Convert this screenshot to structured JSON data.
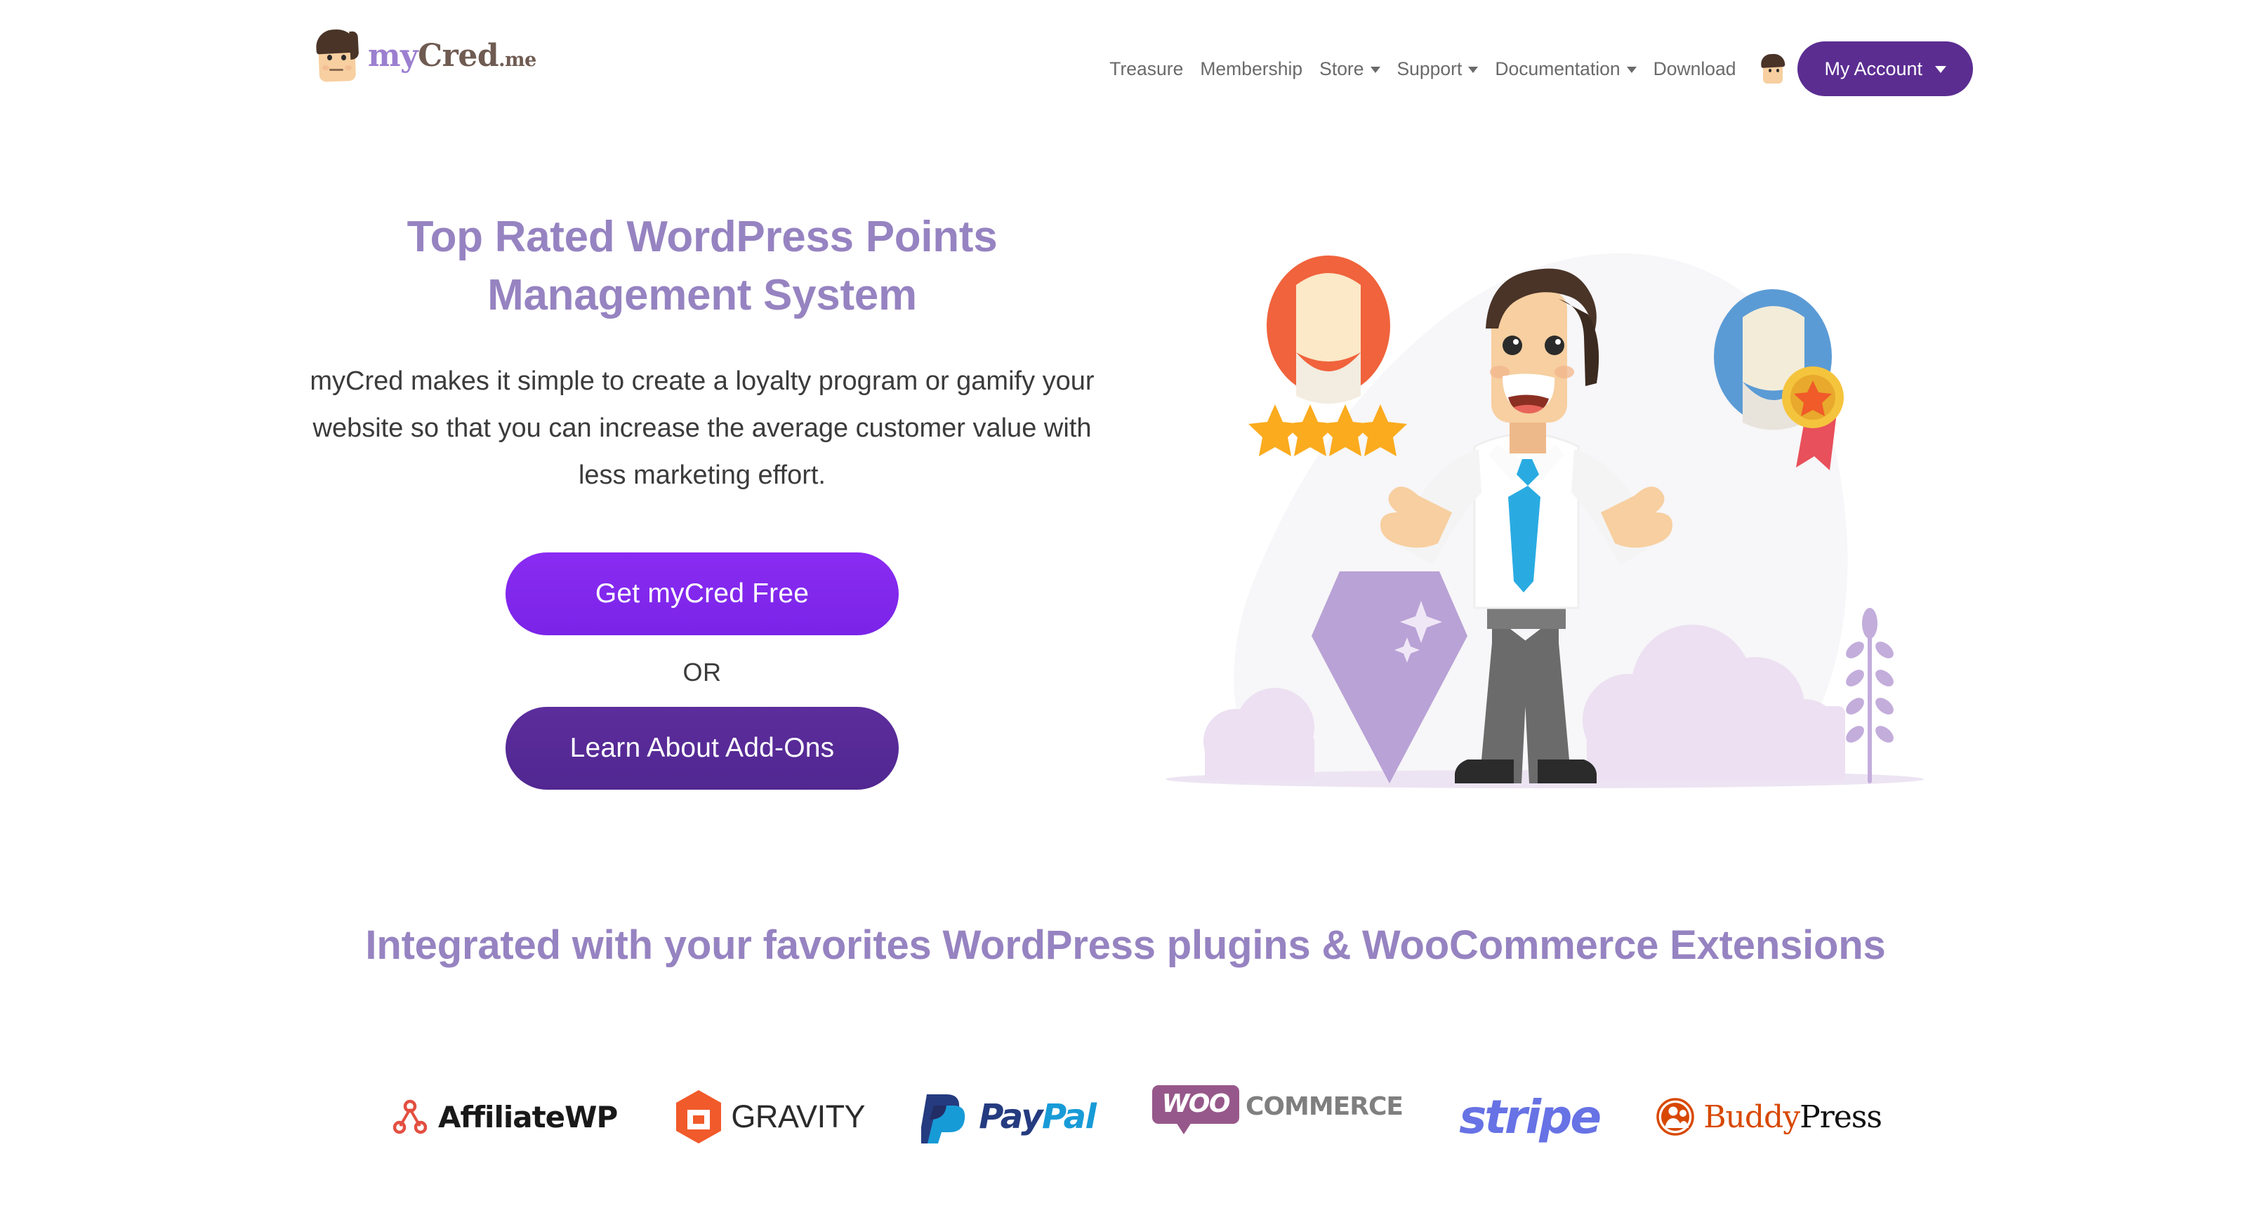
{
  "brand": {
    "logo_icon": "avatar-face-icon",
    "name_part1": "my",
    "name_part2": "Cred",
    "name_part3": ".me"
  },
  "nav": {
    "items": [
      {
        "label": "Treasure",
        "has_dropdown": false,
        "icon": ""
      },
      {
        "label": "Membership",
        "has_dropdown": false,
        "icon": ""
      },
      {
        "label": "Store",
        "has_dropdown": true,
        "icon": "chevron-down-icon"
      },
      {
        "label": "Support",
        "has_dropdown": true,
        "icon": "chevron-down-icon"
      },
      {
        "label": "Documentation",
        "has_dropdown": true,
        "icon": "chevron-down-icon"
      },
      {
        "label": "Download",
        "has_dropdown": false,
        "icon": ""
      }
    ],
    "avatar_icon": "user-avatar-icon",
    "account_button": {
      "label": "My Account",
      "icon": "chevron-down-icon",
      "color": "#5b2d91"
    }
  },
  "hero": {
    "title": "Top Rated WordPress Points Management System",
    "title_color": "#9683c1",
    "subtitle": "myCred makes it simple to create a loyalty program or gamify your website so that you can increase the average customer value with less marketing effort.",
    "primary_cta": {
      "label": "Get myCred Free",
      "color": "#8128ec"
    },
    "divider_label": "OR",
    "secondary_cta": {
      "label": "Learn About Add-Ons",
      "color": "#552a9a"
    },
    "illustration": {
      "name": "happy-businessman-with-rewards-illustration",
      "elements": [
        "orange-avatar-badge",
        "four-star-rating",
        "blue-avatar-badge",
        "gold-medal-ribbon",
        "purple-diamond-gem",
        "purple-cloud-bushes",
        "plant-sprig"
      ],
      "star_count": 4,
      "star_color": "#fbab1e",
      "orange_badge_color": "#f0633c",
      "blue_badge_color": "#5b9bd5",
      "gem_color": "#b9a2d6",
      "shirt_color": "#ffffff",
      "tie_color": "#29abe2",
      "trousers_color": "#6b6b6b",
      "skin_color": "#f7cfa0",
      "hair_color": "#4a3428"
    }
  },
  "integrations": {
    "title": "Integrated with your favorites WordPress plugins & WooCommerce Extensions",
    "title_color": "#9683c1",
    "logos": [
      {
        "id": "affiliatewp",
        "name": "AffiliateWP",
        "icon": "affiliatewp-node-icon",
        "accent": "#e34f41"
      },
      {
        "id": "gravity",
        "name": "GRAVITY",
        "icon": "gravity-forms-hex-icon",
        "accent": "#f15a2b"
      },
      {
        "id": "paypal",
        "name": "PayPal",
        "text_a": "Pay",
        "text_b": "Pal",
        "icon": "paypal-pp-icon",
        "accent": "#253b80",
        "accent2": "#179bd7"
      },
      {
        "id": "woocommerce",
        "name": "WooCommerce",
        "text_a": "WOO",
        "text_b": "COMMERCE",
        "icon": "woocommerce-bubble-icon",
        "accent": "#96588a",
        "accent2": "#7f7f7f"
      },
      {
        "id": "stripe",
        "name": "stripe",
        "icon": "stripe-wordmark",
        "accent": "#6772e5"
      },
      {
        "id": "buddypress",
        "name": "BuddyPress",
        "text_a": "Buddy",
        "text_b": "Press",
        "icon": "buddypress-person-icon",
        "accent": "#d84800",
        "accent2": "#111111"
      }
    ]
  }
}
